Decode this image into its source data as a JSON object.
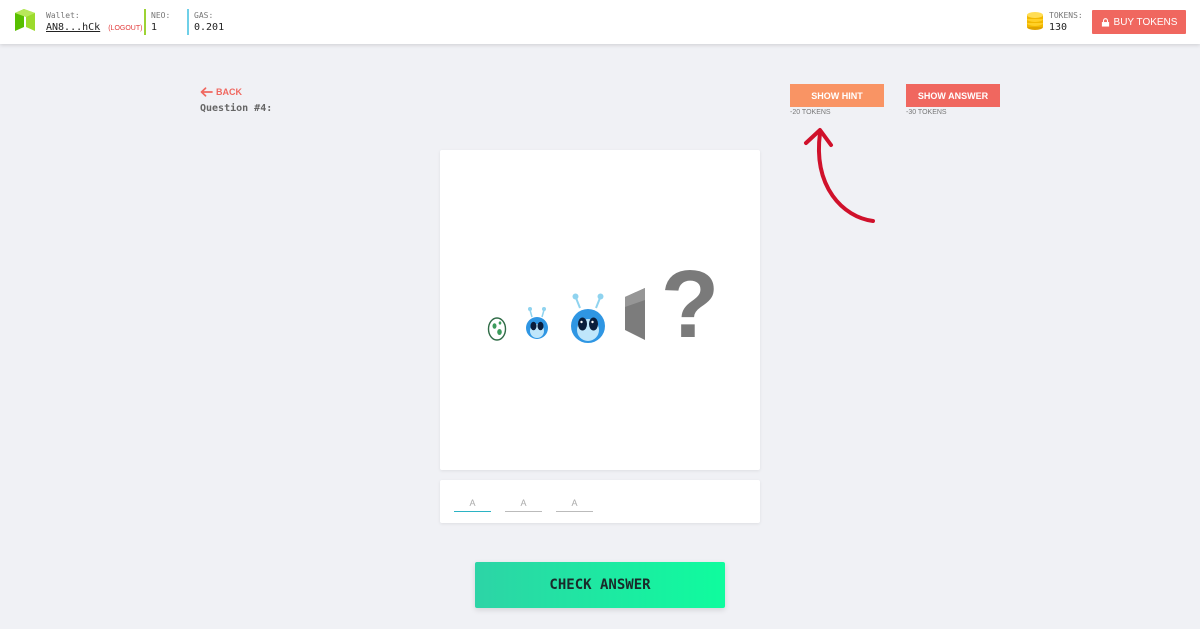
{
  "header": {
    "wallet_caption": "Wallet:",
    "wallet_address": "AN8...hCk",
    "logout_label": "(LOGOUT)",
    "neo_caption": "NEO:",
    "neo_value": "1",
    "gas_caption": "GAS:",
    "gas_value": "0.201",
    "tokens_caption": "TOKENS:",
    "tokens_value": "130",
    "buy_label": "BUY TOKENS"
  },
  "question": {
    "back_label": "BACK",
    "title": "Question #4:",
    "hint_label": "SHOW HINT",
    "hint_cost": "-20 TOKENS",
    "answer_label": "SHOW ANSWER",
    "answer_cost": "-30 TOKENS",
    "puzzle_icons": [
      "egg-icon",
      "small-alien-icon",
      "alien-icon",
      "gray-block-icon",
      "question-mark-icon"
    ],
    "question_mark": "?"
  },
  "answer": {
    "letters": [
      {
        "placeholder": "A"
      },
      {
        "placeholder": "A"
      },
      {
        "placeholder": "A"
      }
    ],
    "check_label": "CHECK ANSWER"
  },
  "colors": {
    "accent_red": "#f0675f",
    "hint_orange": "#f99464",
    "arrow_red": "#d0112b",
    "neo_green": "#9dd334",
    "gas_blue": "#6fd0e8",
    "check_gradient_start": "#2dd4a6",
    "check_gradient_end": "#0ffc9e"
  }
}
